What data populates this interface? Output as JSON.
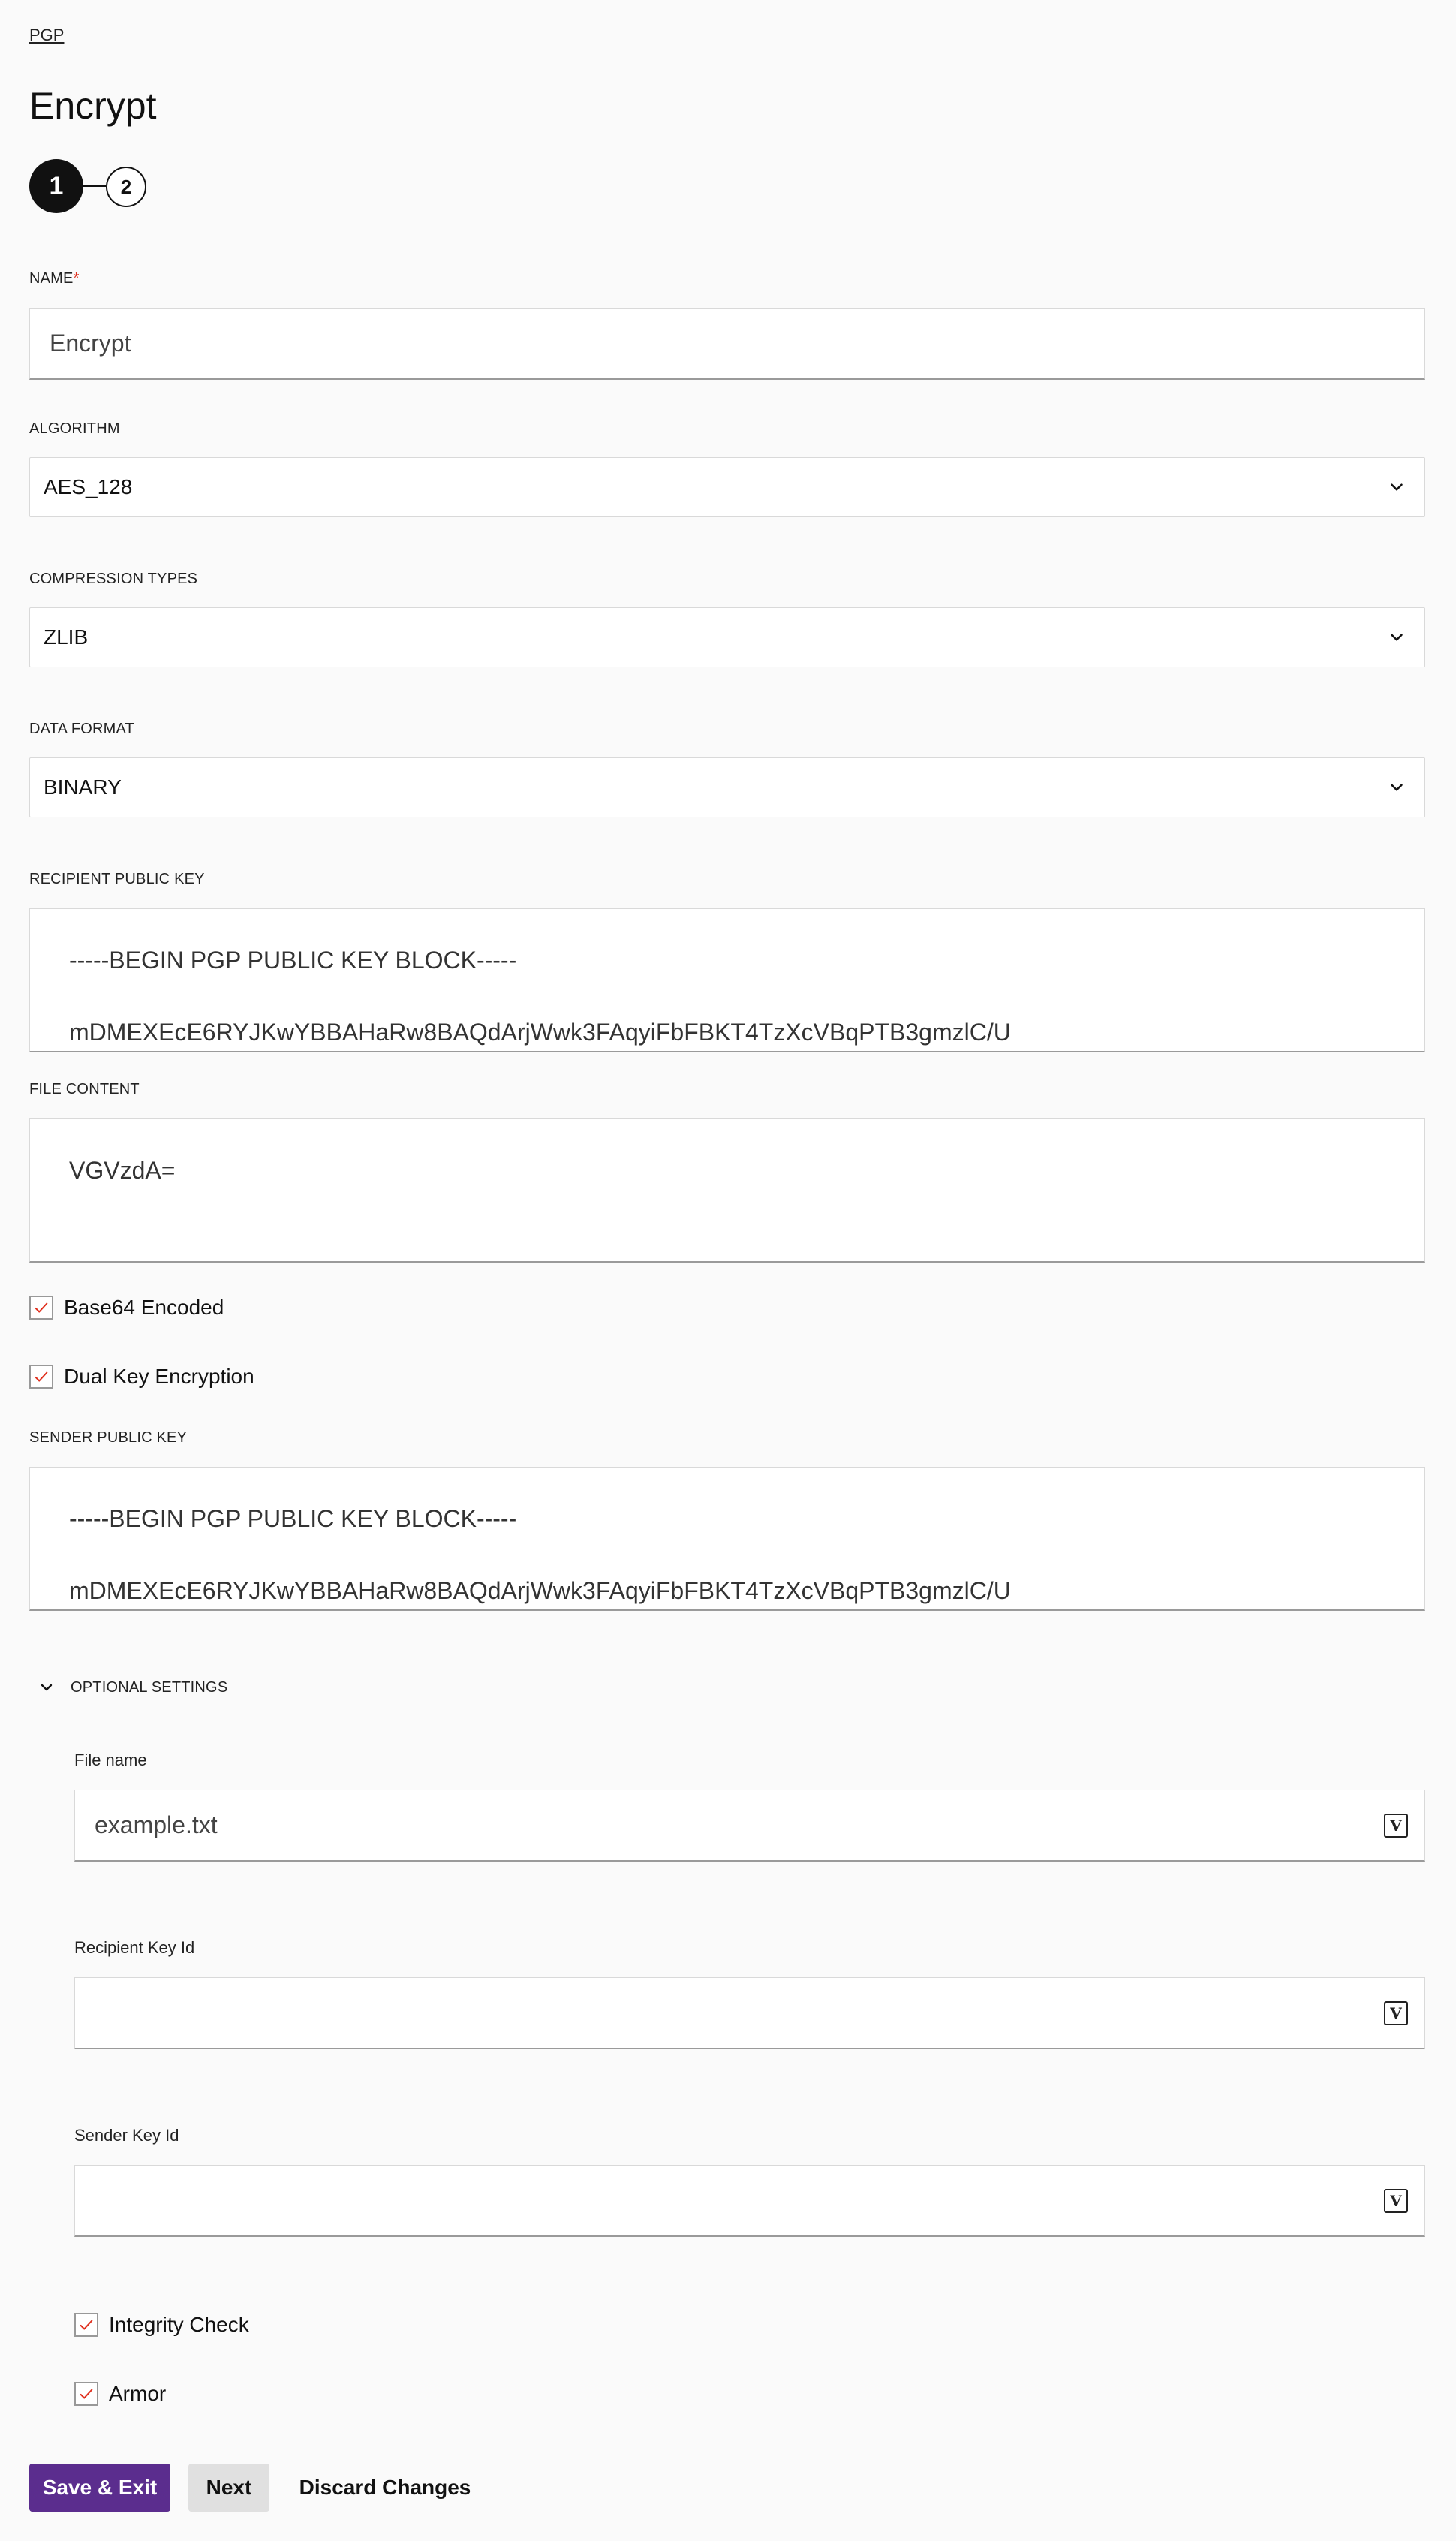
{
  "breadcrumb": "PGP",
  "title": "Encrypt",
  "stepper": {
    "step1": "1",
    "step2": "2"
  },
  "fields": {
    "name": {
      "label": "NAME",
      "required_mark": "*",
      "value": "Encrypt"
    },
    "algorithm": {
      "label": "ALGORITHM",
      "value": "AES_128"
    },
    "compression": {
      "label": "COMPRESSION TYPES",
      "value": "ZLIB"
    },
    "data_format": {
      "label": "DATA FORMAT",
      "value": "BINARY"
    },
    "recipient_key": {
      "label": "RECIPIENT PUBLIC KEY",
      "line1": "-----BEGIN PGP PUBLIC KEY BLOCK-----",
      "line2": "mDMEXEcE6RYJKwYBBAHaRw8BAQdArjWwk3FAqyiFbFBKT4TzXcVBqPTB3gmzlC/U"
    },
    "file_content": {
      "label": "FILE CONTENT",
      "value": "VGVzdA="
    },
    "base64": {
      "label": "Base64 Encoded",
      "checked": true
    },
    "dual_key": {
      "label": "Dual Key Encryption",
      "checked": true
    },
    "sender_key": {
      "label": "SENDER PUBLIC KEY",
      "line1": "-----BEGIN PGP PUBLIC KEY BLOCK-----",
      "line2": "mDMEXEcE6RYJKwYBBAHaRw8BAQdArjWwk3FAqyiFbFBKT4TzXcVBqPTB3gmzlC/U"
    }
  },
  "optional": {
    "toggle_label": "OPTIONAL SETTINGS",
    "file_name": {
      "label": "File name",
      "value": "example.txt"
    },
    "recipient_key_id": {
      "label": "Recipient Key Id",
      "value": ""
    },
    "sender_key_id": {
      "label": "Sender Key Id",
      "value": ""
    },
    "integrity_check": {
      "label": "Integrity Check",
      "checked": true
    },
    "armor": {
      "label": "Armor",
      "checked": true
    },
    "variable_icon_glyph": "V"
  },
  "actions": {
    "save_exit": "Save & Exit",
    "next": "Next",
    "discard": "Discard Changes"
  },
  "colors": {
    "primary": "#5b2d8e",
    "required": "#e0301e",
    "check": "#e0301e"
  }
}
